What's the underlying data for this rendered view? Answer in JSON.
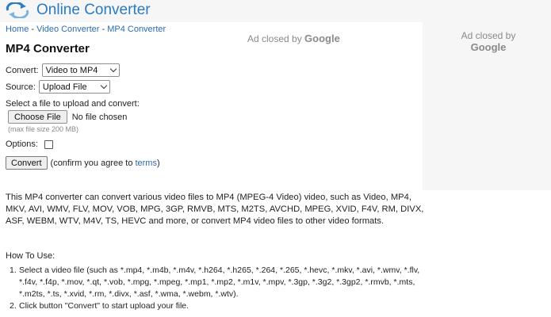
{
  "header": {
    "logo_text": "Online Converter"
  },
  "breadcrumb": {
    "home": "Home",
    "sep1": " - ",
    "video_converter": "Video Converter",
    "sep2": " - ",
    "mp4_converter": "MP4 Converter"
  },
  "page_title": "MP4 Converter",
  "form": {
    "convert_label": "Convert:",
    "convert_value": "Video to MP4",
    "source_label": "Source:",
    "source_value": "Upload File",
    "select_prompt": "Select a file to upload and convert:",
    "choose_file_label": "Choose File",
    "no_file_text": "No file chosen",
    "max_size_note": "(max file size 200 MB)",
    "options_label": "Options:",
    "convert_button": "Convert",
    "confirm_text": "(confirm you agree to",
    "terms_link": "terms",
    "confirm_close": ")"
  },
  "ads": {
    "center_prefix": "Ad closed by ",
    "center_brand": "Google",
    "right_line1": "Ad closed by",
    "right_line2": "Google"
  },
  "description": "This MP4 converter can convert various video files to MP4 (MPEG-4 Video) video, such as Video, MP4, MKV, AVI, WMV, FLV, MOV, VOB, MPG, 3GP, RMVB, MTS, M2TS, AVCHD, MPEG, XVID, F4V, RM, DIVX, ASF, WEBM, WTV, M4V, TS, HEVC and more, or convert MP4 video files to other video formats.",
  "how_to": {
    "title": "How To Use:",
    "steps": [
      {
        "num": "1.",
        "text": "Select a video file (such as *.mp4, *.m4b, *.m4v, *.h264, *.h265, *.264, *.265, *.hevc, *.mkv, *.avi, *.wmv, *.flv, *.f4v, *.f4p, *.mov, *.qt, *.vob, *.mpg, *.mpeg, *.mp1, *.mp2, *.m1v, *.mpv, *.3gp, *.3g2, *.3gp2, *.rmvb, *.mts, *.m2ts, *.ts, *.xvid, *.rm, *.divx, *.asf, *.wma, *.webm, *.wtv)."
      },
      {
        "num": "2.",
        "text": "Click button \"Convert\" to start upload your file."
      }
    ]
  },
  "colors": {
    "brand": "#2b7bc0",
    "link": "#2b6cb0",
    "header_bg": "#f6f6f6"
  },
  "icons": {
    "logo": "converter-arrows-icon",
    "dropdown": "chevron-down-icon",
    "checkbox": "checkbox-icon"
  }
}
